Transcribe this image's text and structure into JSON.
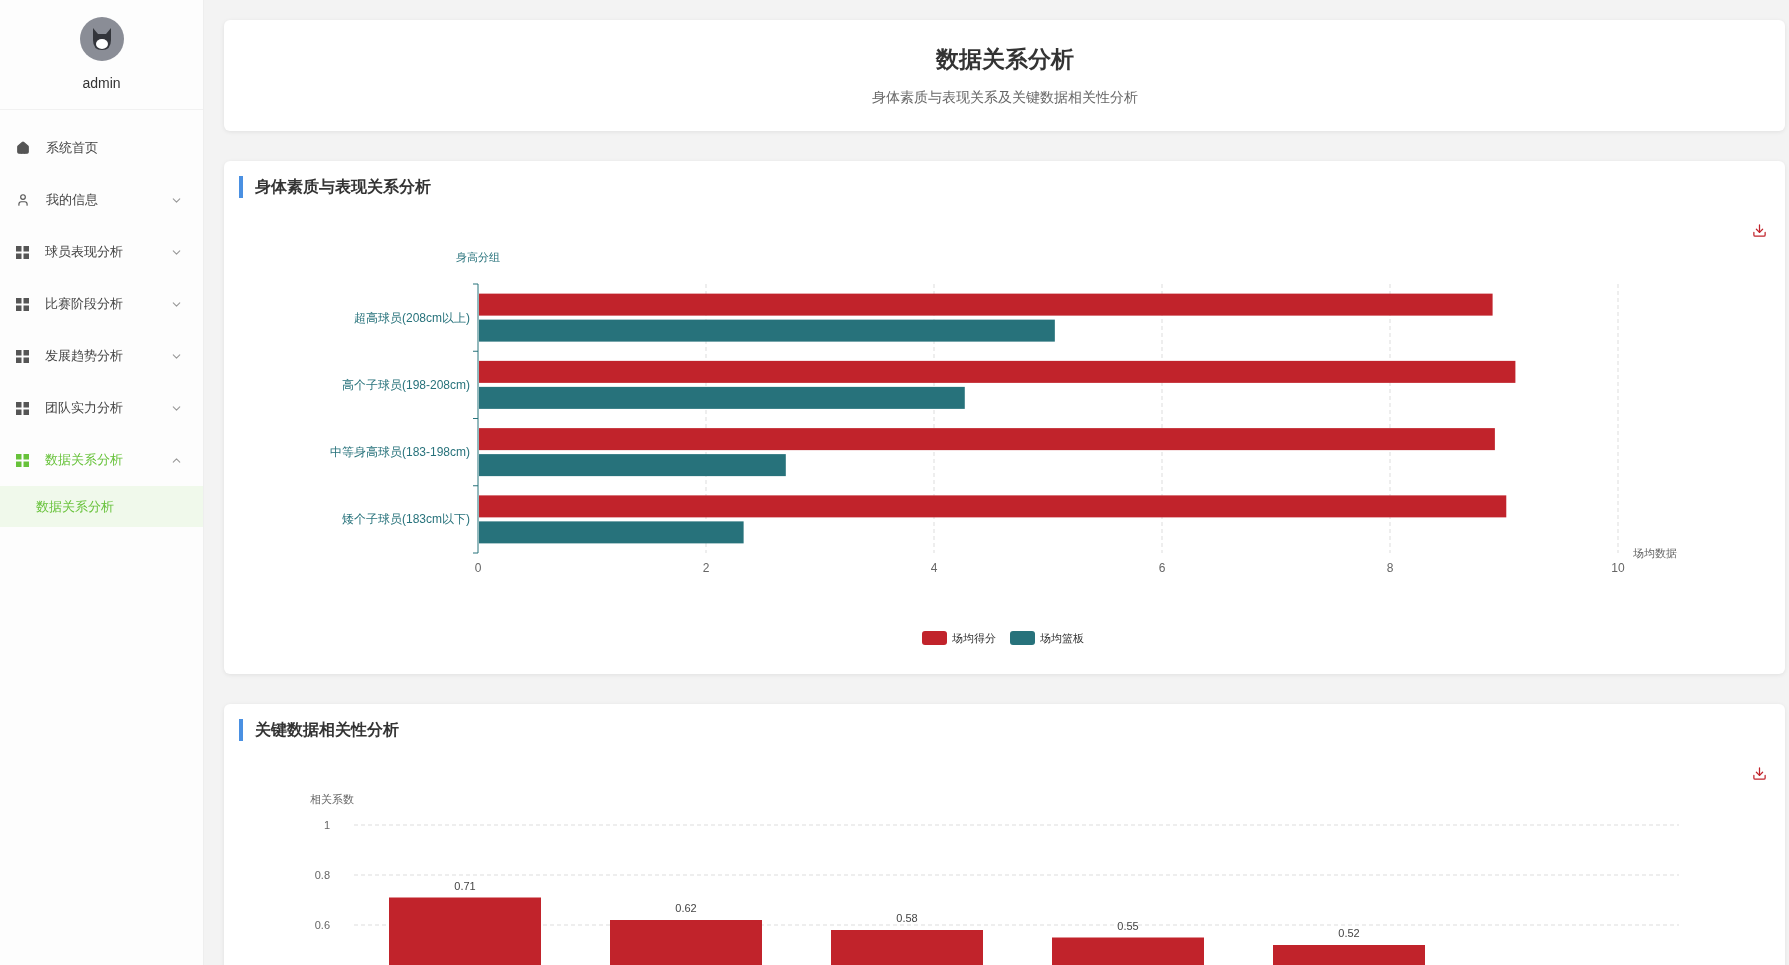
{
  "sidebar": {
    "user": {
      "name": "admin"
    },
    "items": [
      {
        "label": "系统首页",
        "kind": "home",
        "selected": false
      },
      {
        "label": "我的信息",
        "kind": "user",
        "expanded": false,
        "selected": false
      },
      {
        "label": "球员表现分析",
        "kind": "grid",
        "expanded": false,
        "selected": false
      },
      {
        "label": "比赛阶段分析",
        "kind": "grid",
        "expanded": false,
        "selected": false
      },
      {
        "label": "发展趋势分析",
        "kind": "grid",
        "expanded": false,
        "selected": false
      },
      {
        "label": "团队实力分析",
        "kind": "grid",
        "expanded": false,
        "selected": false
      },
      {
        "label": "数据关系分析",
        "kind": "grid",
        "expanded": true,
        "selected": true,
        "children": [
          {
            "label": "数据关系分析",
            "selected": true
          }
        ]
      }
    ]
  },
  "header": {
    "title": "数据关系分析",
    "subtitle": "身体素质与表现关系及关键数据相关性分析"
  },
  "panels": [
    {
      "title": "身体素质与表现关系分析",
      "chart_data": {
        "type": "bar",
        "orientation": "horizontal",
        "ylabel": "身高分组",
        "xlabel": "场均数据",
        "categories": [
          "超高球员(208cm以上)",
          "高个子球员(198-208cm)",
          "中等身高球员(183-198cm)",
          "矮个子球员(183cm以下)"
        ],
        "series": [
          {
            "name": "场均得分",
            "color": "#c1232b",
            "values": [
              8.9,
              9.1,
              8.92,
              9.02
            ]
          },
          {
            "name": "场均篮板",
            "color": "#27727b",
            "values": [
              5.06,
              4.27,
              2.7,
              2.33
            ]
          }
        ],
        "xlim": [
          0,
          10
        ],
        "xticks": [
          0,
          2,
          4,
          6,
          8,
          10
        ],
        "grid": true,
        "legend": true
      }
    },
    {
      "title": "关键数据相关性分析",
      "chart_data": {
        "type": "bar",
        "ylabel": "相关系数",
        "series": [
          {
            "color": "#c1232b",
            "values": [
              0.71,
              0.62,
              0.58,
              0.55,
              0.52
            ]
          }
        ],
        "ylim": [
          0,
          1
        ],
        "grid": true,
        "yticks": [
          {
            "value": 0.6,
            "label": "0.6"
          },
          {
            "value": 0.8,
            "label": "0.8"
          },
          {
            "value": 1,
            "label": "1"
          }
        ],
        "data_labels": true
      }
    }
  ]
}
